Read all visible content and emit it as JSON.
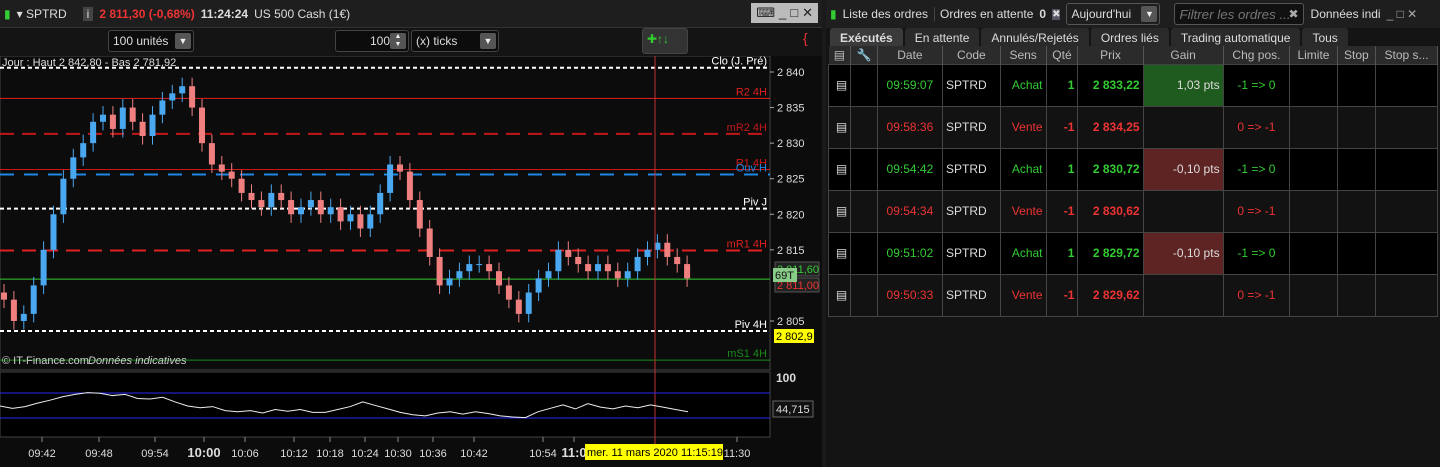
{
  "header": {
    "symbol": "SPTRD",
    "price": "2 811,30 (-0,68%)",
    "time": "11:24:24",
    "instrument": "US 500 Cash (1€)"
  },
  "toolbar": {
    "units": "100 unités",
    "ticks_value": "100",
    "ticks_label": "(x) ticks"
  },
  "chart": {
    "info": "Jour : Haut 2 842,80 - Bas 2 781,92",
    "copyright": "© IT-Finance.com",
    "disclaimer": "Données indicatives",
    "levels": [
      {
        "label": "Clo (J. Pré)",
        "value": 2840.6,
        "color": "#ffffff",
        "dash": "4,3"
      },
      {
        "label": "R2 4H",
        "value": 2836.3,
        "color": "#e02020",
        "dash": ""
      },
      {
        "label": "mR2 4H",
        "value": 2831.3,
        "color": "#c01818",
        "dash": "14,8"
      },
      {
        "label": "R1 4H",
        "value": 2826.3,
        "color": "#d01818",
        "dash": ""
      },
      {
        "label": "Ouv H",
        "value": 2825.6,
        "color": "#1e88e5",
        "dash": "14,10"
      },
      {
        "label": "Piv J",
        "value": 2820.8,
        "color": "#ffffff",
        "dash": "4,3"
      },
      {
        "label": "mR1 4H",
        "value": 2814.9,
        "color": "#e02020",
        "dash": "14,8"
      },
      {
        "label": "Piv 4H",
        "value": 2803.6,
        "color": "#ffffff",
        "dash": "4,3"
      },
      {
        "label": "mS1 4H",
        "value": 2799.5,
        "color": "#1a8a1a",
        "dash": ""
      }
    ],
    "axis_labels": [
      "2 840",
      "2 835",
      "2 830",
      "2 825",
      "2 820",
      "2 815",
      "2 805"
    ],
    "bid": "2 811,60",
    "ask": "2 811,00",
    "spread_tag": "69T",
    "marker_price": "2 802,9",
    "rsi_top": "100",
    "rsi_value": "44,715",
    "time_labels": [
      "09:42",
      "09:48",
      "09:54",
      "10:00",
      "10:06",
      "10:12",
      "10:18",
      "10:24",
      "10:30",
      "10:36",
      "10:42",
      "10:54",
      "11:0",
      "11:30"
    ],
    "crosshair_date": "mer. 11 mars 2020 11:15:19"
  },
  "chart_data": {
    "type": "candlestick",
    "ylim": [
      2800,
      2842
    ],
    "closes": [
      2808,
      2805,
      2806,
      2810,
      2815,
      2820,
      2825,
      2828,
      2830,
      2833,
      2834,
      2832,
      2835,
      2833,
      2831,
      2834,
      2836,
      2837,
      2838,
      2835,
      2830,
      2827,
      2826,
      2825,
      2823,
      2822,
      2821,
      2823,
      2822,
      2820,
      2821,
      2822,
      2820,
      2821,
      2819,
      2820,
      2818,
      2820,
      2823,
      2827,
      2826,
      2822,
      2818,
      2814,
      2810,
      2811,
      2812,
      2813,
      2813,
      2812,
      2810,
      2808,
      2806,
      2809,
      2811,
      2812,
      2815,
      2814,
      2813,
      2812,
      2813,
      2812,
      2811,
      2812,
      2814,
      2815,
      2816,
      2814,
      2813,
      2811
    ],
    "rsi": [
      50,
      46,
      49,
      55,
      60,
      66,
      70,
      73,
      72,
      68,
      70,
      63,
      62,
      65,
      57,
      50,
      47,
      49,
      42,
      40,
      42,
      38,
      44,
      41,
      44,
      39,
      39,
      44,
      49,
      57,
      51,
      45,
      39,
      35,
      33,
      38,
      40,
      36,
      40,
      37,
      33,
      31,
      30,
      40,
      46,
      52,
      45,
      54,
      48,
      45,
      50,
      47,
      52,
      48,
      44,
      40
    ]
  },
  "orders": {
    "title": "Liste des ordres",
    "pending_label": "Ordres en attente",
    "pending_count": "0",
    "period": "Aujourd'hui",
    "filter_placeholder": "Filtrer les ordres ...",
    "data_label": "Données indi",
    "tabs": [
      "Exécutés",
      "En attente",
      "Annulés/Rejetés",
      "Ordres liés",
      "Trading automatique",
      "Tous"
    ],
    "columns": [
      "Date",
      "Code",
      "Sens",
      "Qté",
      "Prix",
      "Gain",
      "Chg pos.",
      "Limite",
      "Stop",
      "Stop s..."
    ],
    "rows": [
      {
        "date": "09:59:07",
        "code": "SPTRD",
        "sens": "Achat",
        "qty": "1",
        "price": "2 833,22",
        "gain": "1,03 pts",
        "chg": "-1 => 0",
        "side": "buy",
        "gain_bg": "#1f5a1f"
      },
      {
        "date": "09:58:36",
        "code": "SPTRD",
        "sens": "Vente",
        "qty": "-1",
        "price": "2 834,25",
        "gain": "",
        "chg": "0 => -1",
        "side": "sell",
        "gain_bg": ""
      },
      {
        "date": "09:54:42",
        "code": "SPTRD",
        "sens": "Achat",
        "qty": "1",
        "price": "2 830,72",
        "gain": "-0,10 pts",
        "chg": "-1 => 0",
        "side": "buy",
        "gain_bg": "#5e2424"
      },
      {
        "date": "09:54:34",
        "code": "SPTRD",
        "sens": "Vente",
        "qty": "-1",
        "price": "2 830,62",
        "gain": "",
        "chg": "0 => -1",
        "side": "sell",
        "gain_bg": ""
      },
      {
        "date": "09:51:02",
        "code": "SPTRD",
        "sens": "Achat",
        "qty": "1",
        "price": "2 829,72",
        "gain": "-0,10 pts",
        "chg": "-1 => 0",
        "side": "buy",
        "gain_bg": "#5e2424"
      },
      {
        "date": "09:50:33",
        "code": "SPTRD",
        "sens": "Vente",
        "qty": "-1",
        "price": "2 829,62",
        "gain": "",
        "chg": "0 => -1",
        "side": "sell",
        "gain_bg": ""
      }
    ]
  }
}
